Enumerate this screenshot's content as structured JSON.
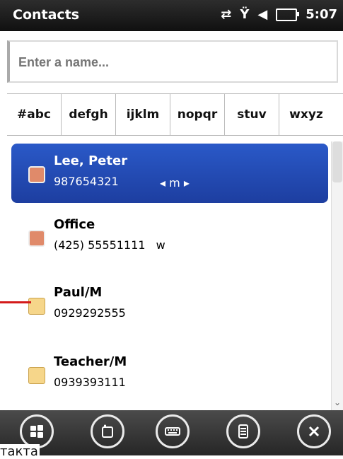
{
  "top_bar": {
    "title": "Contacts",
    "time": "5:07",
    "icons": [
      "network-sync-icon",
      "signal-icon",
      "volume-icon",
      "battery-icon"
    ]
  },
  "search": {
    "placeholder": "Enter a name..."
  },
  "alpha_tabs": [
    "#abc",
    "defgh",
    "ijklm",
    "nopqr",
    "stuv",
    "wxyz"
  ],
  "contacts": [
    {
      "name": "Lee, Peter",
      "phone": "987654321",
      "tag": "m",
      "selected": true,
      "icon": "contact-person-icon"
    },
    {
      "name": "Office",
      "phone": "(425) 55551111",
      "tag": "w",
      "selected": false,
      "icon": "contact-person-icon"
    },
    {
      "name": "Paul/M",
      "phone": "0929292555",
      "tag": "",
      "selected": false,
      "icon": "sim-contact-icon"
    },
    {
      "name": "Teacher/M",
      "phone": "0939393111",
      "tag": "",
      "selected": false,
      "icon": "sim-contact-icon"
    }
  ],
  "toolbar": {
    "buttons": [
      "windows-start-icon",
      "new-contact-icon",
      "keyboard-icon",
      "menu-icon",
      "close-icon"
    ]
  },
  "annotation": {
    "caption": "такта"
  },
  "colors": {
    "selection": "#2a59c8",
    "redline": "#d41a1a"
  }
}
